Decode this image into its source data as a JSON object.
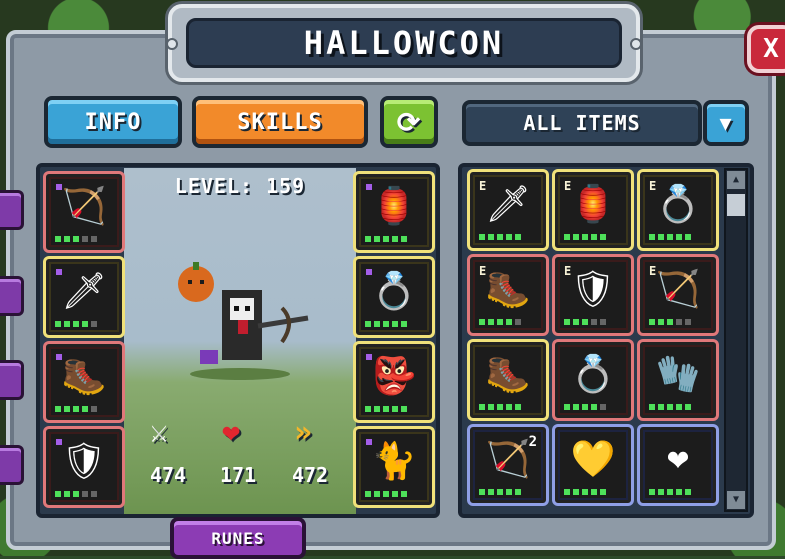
{
  "title": "HALLOWCON",
  "close_label": "X",
  "tabs": {
    "info_label": "INFO",
    "skills_label": "SKILLS",
    "refresh_glyph": "⟳"
  },
  "filter": {
    "selected": "ALL ITEMS",
    "dropdown_glyph": "▼"
  },
  "hero": {
    "level_label": "LEVEL: 159",
    "figure_glyph": "💀",
    "stats": {
      "attack_icon": "⚔",
      "attack_value": "474",
      "health_icon": "❤",
      "health_value": "171",
      "speed_icon": "»",
      "speed_value": "472"
    }
  },
  "equipped_left": [
    {
      "icon": "crossbow-icon",
      "glyph": "🏹",
      "rarity": "red",
      "pips": 3
    },
    {
      "icon": "scythe-blade-icon",
      "glyph": "🗡",
      "rarity": "yellow",
      "pips": 4
    },
    {
      "icon": "golden-boot-icon",
      "glyph": "🥾",
      "rarity": "red",
      "pips": 4
    },
    {
      "icon": "dark-armor-icon",
      "glyph": "🛡",
      "rarity": "red",
      "pips": 3
    }
  ],
  "equipped_right": [
    {
      "icon": "totem-amulet-icon",
      "glyph": "🏮",
      "rarity": "yellow",
      "pips": 5
    },
    {
      "icon": "skull-ring-icon",
      "glyph": "💍",
      "rarity": "yellow",
      "pips": 5
    },
    {
      "icon": "goblin-pet-icon",
      "glyph": "👺",
      "rarity": "yellow",
      "pips": 5
    },
    {
      "icon": "shadow-cat-icon",
      "glyph": "🐈",
      "rarity": "yellow",
      "pips": 5
    }
  ],
  "inventory": [
    {
      "icon": "scythe-blade-icon",
      "glyph": "🗡",
      "rarity": "yellow",
      "tag": "E",
      "pips": 5
    },
    {
      "icon": "totem-amulet-icon",
      "glyph": "🏮",
      "rarity": "yellow",
      "tag": "E",
      "pips": 5
    },
    {
      "icon": "skull-ring-icon",
      "glyph": "💍",
      "rarity": "yellow",
      "tag": "E",
      "pips": 5
    },
    {
      "icon": "golden-boot-icon",
      "glyph": "🥾",
      "rarity": "red",
      "tag": "E",
      "pips": 4
    },
    {
      "icon": "dark-armor-icon",
      "glyph": "🛡",
      "rarity": "red",
      "tag": "E",
      "pips": 3
    },
    {
      "icon": "crossbow-icon",
      "glyph": "🏹",
      "rarity": "red",
      "tag": "E",
      "pips": 3
    },
    {
      "icon": "dark-boot-icon",
      "glyph": "🥾",
      "rarity": "yellow",
      "tag": "",
      "pips": 5
    },
    {
      "icon": "skull-ring-icon",
      "glyph": "💍",
      "rarity": "red",
      "tag": "",
      "pips": 4
    },
    {
      "icon": "golden-glove-icon",
      "glyph": "🧤",
      "rarity": "red",
      "tag": "",
      "pips": 5
    },
    {
      "icon": "bow-icon",
      "glyph": "🏹",
      "rarity": "blue",
      "tag": "",
      "count": "2",
      "pips": 5
    },
    {
      "icon": "yellow-gem-amulet-icon",
      "glyph": "💛",
      "rarity": "blue",
      "tag": "",
      "pips": 5
    },
    {
      "icon": "red-gem-amulet-icon",
      "glyph": "❤",
      "rarity": "blue",
      "tag": "",
      "pips": 5
    }
  ],
  "runes_label": "RUNES"
}
